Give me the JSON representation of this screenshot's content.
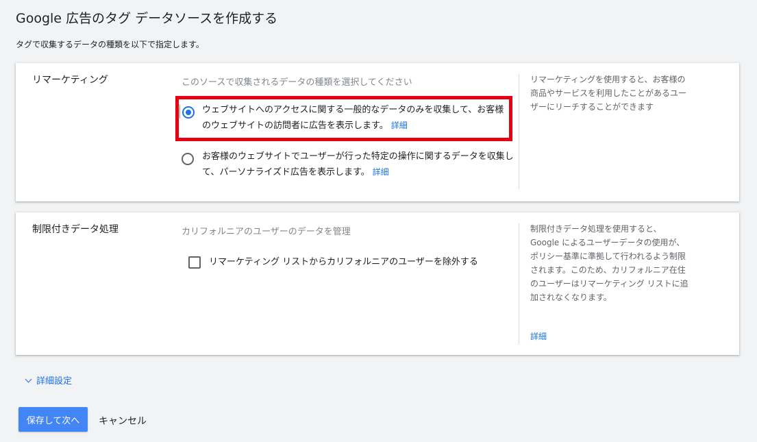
{
  "header": {
    "title": "Google 広告のタグ データソースを作成する",
    "subtitle": "タグで収集するデータの種類を以下で指定します。"
  },
  "remarketing": {
    "title": "リマーケティング",
    "hint": "このソースで収集されるデータの種類を選択してください",
    "options": [
      {
        "label": "ウェブサイトへのアクセスに関する一般的なデータのみを収集して、お客様のウェブサイトの訪問者に広告を表示します。",
        "link": "詳細",
        "selected": true
      },
      {
        "label": "お客様のウェブサイトでユーザーが行った特定の操作に関するデータを収集して、パーソナライズド広告を表示します。",
        "link": "詳細",
        "selected": false
      }
    ],
    "help": "リマーケティングを使用すると、お客様の商品やサービスを利用したことがあるユーザーにリーチすることができます"
  },
  "restricted": {
    "title": "制限付きデータ処理",
    "hint": "カリフォルニアのユーザーのデータを管理",
    "checkbox_label": "リマーケティング リストからカリフォルニアのユーザーを除外する",
    "checked": false,
    "help": "制限付きデータ処理を使用すると、Google によるユーザーデータの使用が、ポリシー基準に準拠して行われるよう制限されます。このため、カリフォルニア在住のユーザーはリマーケティング リストに追加されなくなります。",
    "help_link": "詳細"
  },
  "advanced": {
    "label": "詳細設定"
  },
  "footer": {
    "save_label": "保存して次へ",
    "cancel_label": "キャンセル"
  },
  "colors": {
    "accent": "#1a73e8",
    "primary_button": "#4285f4",
    "highlight_border": "#e60012"
  }
}
